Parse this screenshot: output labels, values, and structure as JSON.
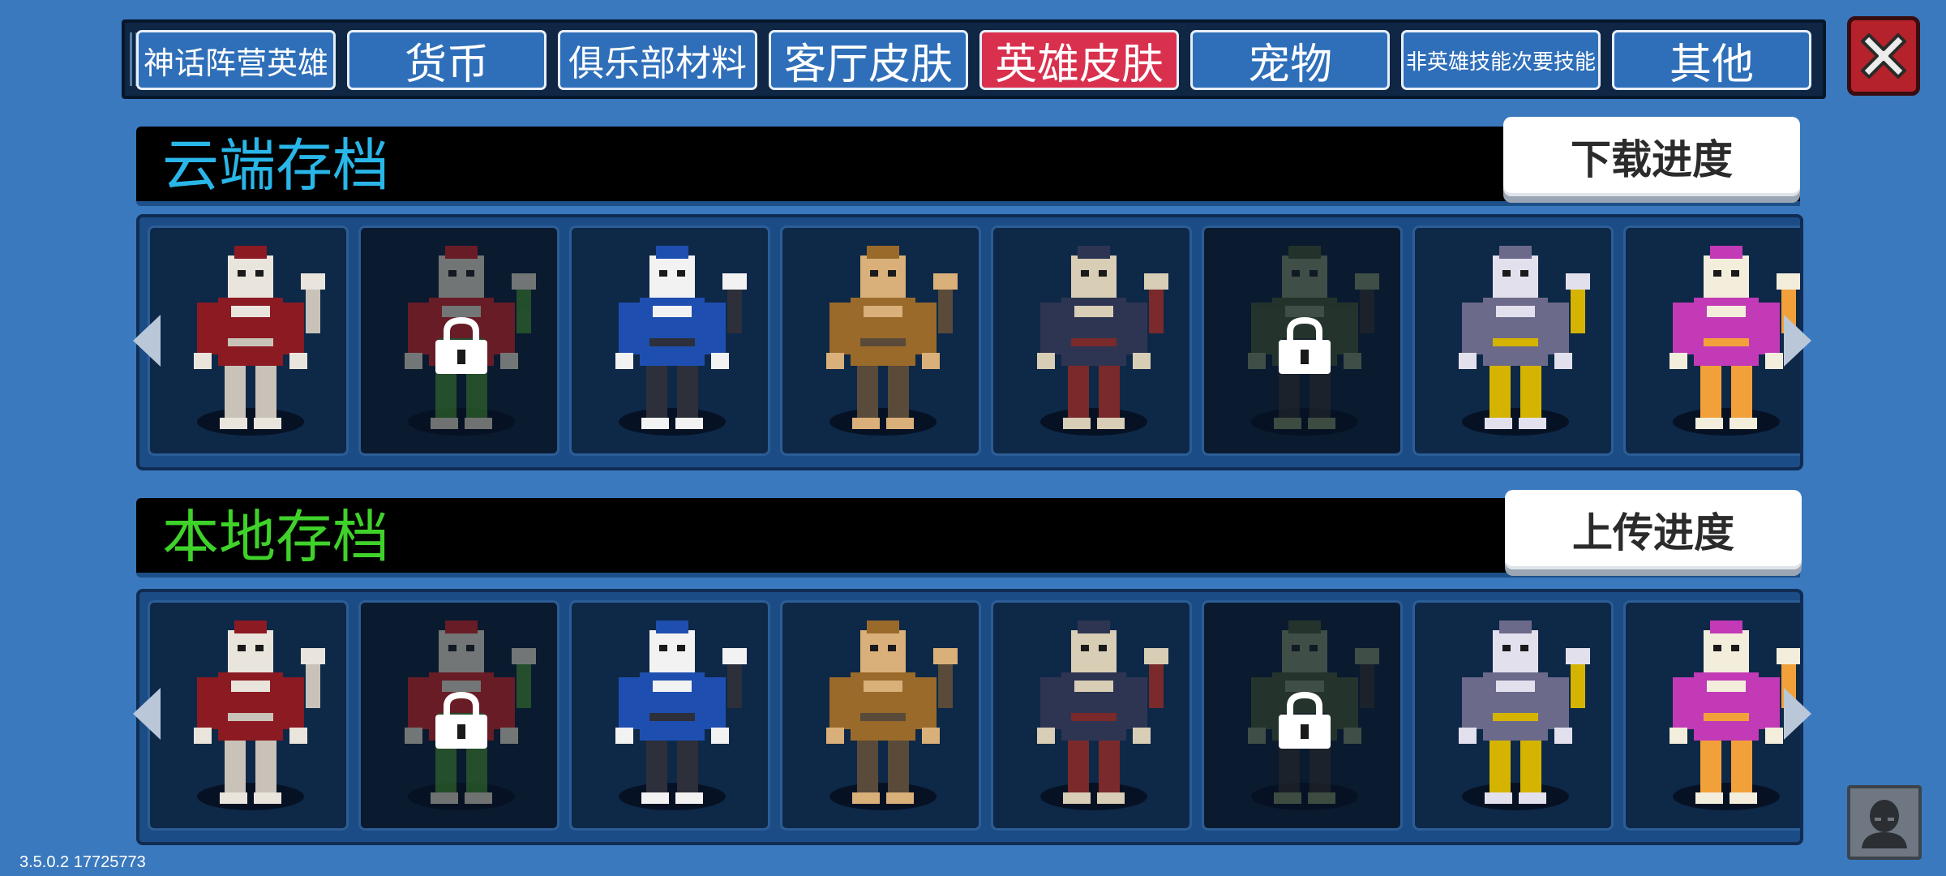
{
  "tabs": [
    {
      "label": "神话阵营英雄",
      "active": false,
      "size": 38
    },
    {
      "label": "货币",
      "active": false,
      "size": 52
    },
    {
      "label": "俱乐部材料",
      "active": false,
      "size": 44
    },
    {
      "label": "客厅皮肤",
      "active": false,
      "size": 52
    },
    {
      "label": "英雄皮肤",
      "active": true,
      "size": 52
    },
    {
      "label": "宠物",
      "active": false,
      "size": 52
    },
    {
      "label": "非英雄技能次要技能",
      "active": false,
      "size": 26
    },
    {
      "label": "其他",
      "active": false,
      "size": 52
    }
  ],
  "cloud": {
    "title": "云端存档",
    "title_color": "#29b6e8",
    "button": "下载进度"
  },
  "local": {
    "title": "本地存档",
    "title_color": "#3fd22a",
    "button": "上传进度"
  },
  "heroes": [
    {
      "name": "werewolf",
      "locked": false,
      "primary": "#8b1a22",
      "secondary": "#e9e4dc",
      "accent": "#c9c2b8"
    },
    {
      "name": "santa",
      "locked": true,
      "primary": "#b61f1f",
      "secondary": "#c8c2b0",
      "accent": "#3a7a2a"
    },
    {
      "name": "knight",
      "locked": false,
      "primary": "#1e4fb0",
      "secondary": "#f2f2f2",
      "accent": "#2d2f3a"
    },
    {
      "name": "gladiator",
      "locked": false,
      "primary": "#9a6a2a",
      "secondary": "#d9b07a",
      "accent": "#5a4a3a"
    },
    {
      "name": "axe-warrior",
      "locked": false,
      "primary": "#2e3552",
      "secondary": "#d8cdb5",
      "accent": "#7a2a2a"
    },
    {
      "name": "soldier",
      "locked": true,
      "primary": "#3a4a2a",
      "secondary": "#6c7a5a",
      "accent": "#2a2a2a"
    },
    {
      "name": "dark-knight",
      "locked": false,
      "primary": "#6c6a8a",
      "secondary": "#e3e0ee",
      "accent": "#d4b400"
    },
    {
      "name": "witch",
      "locked": false,
      "primary": "#c23ab6",
      "secondary": "#f3eddc",
      "accent": "#f2a13a"
    }
  ],
  "version": "3.5.0.2 17725773"
}
